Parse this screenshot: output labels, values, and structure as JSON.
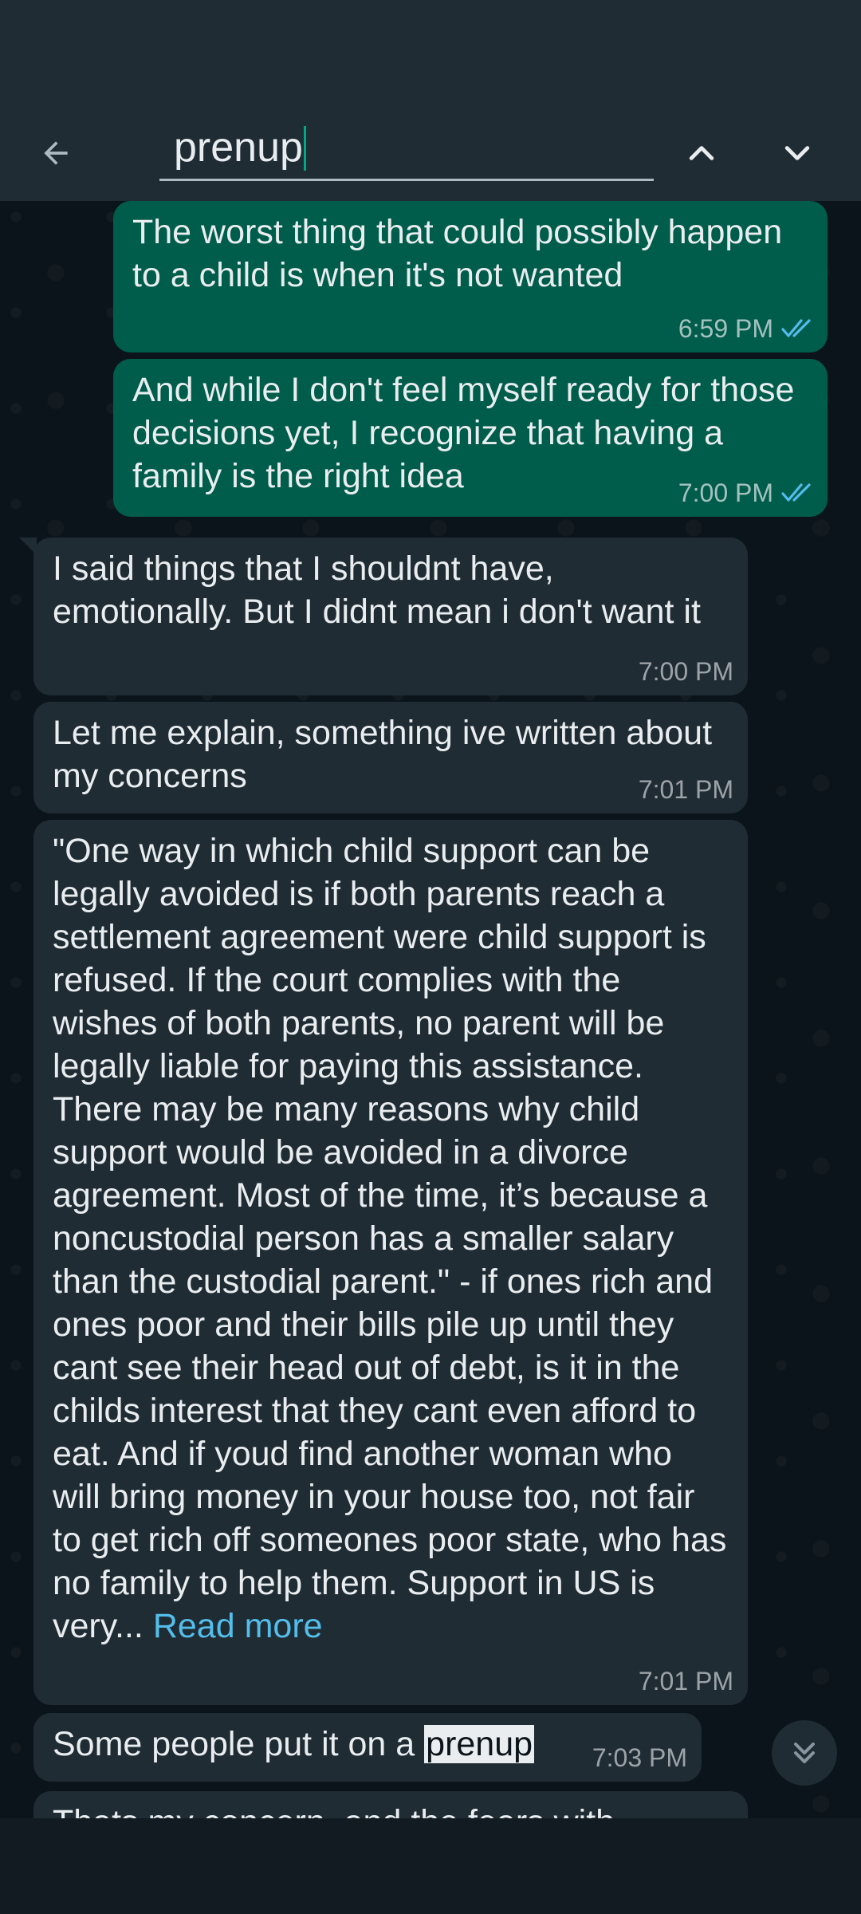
{
  "search": {
    "value": "prenup"
  },
  "messages": [
    {
      "type": "out",
      "text": "The worst thing that could possibly happen to a child is when it's not wanted",
      "time": "6:59 PM"
    },
    {
      "type": "out",
      "text": "And while I don't feel myself ready for those decisions yet, I recognize that having a family is the right idea",
      "time": "7:00 PM"
    },
    {
      "type": "in",
      "text": "I said things that I shouldnt have, emotionally. But I didnt mean i don't want it",
      "time": "7:00 PM"
    },
    {
      "type": "in",
      "text": "Let me explain, something ive written about my concerns",
      "time": "7:01 PM"
    },
    {
      "type": "in",
      "text": "\"One way in which child support can be legally avoided is if both parents reach a settlement agreement were child support is refused. If the court complies with the wishes of both parents, no parent will be legally liable for paying this assistance. There may be many reasons why child support would be avoided in a divorce agreement. Most of the time, it’s because a noncustodial person has a smaller salary than the custodial parent.\" - if ones rich and ones poor and their bills pile up until they cant see their head out of debt, is it in the childs interest that they cant even afford to eat. And if youd find another woman who will bring money in your house too, not fair to get rich off someones poor state, who has no family to help them. Support in US is very...",
      "read_more": "Read more",
      "time": "7:01 PM"
    },
    {
      "type": "in",
      "text_before": "Some people put it on a ",
      "highlight": "prenup",
      "time": "7:03 PM"
    },
    {
      "type": "in",
      "text": "Thats my concern, and the fears with"
    }
  ],
  "colors": {
    "outgoing_bubble": "#005c4b",
    "incoming_bubble": "#202c33",
    "link": "#53bdeb",
    "read_tick": "#53bdeb"
  },
  "icons": {
    "back": "arrow-left",
    "prev": "chevron-up",
    "next": "chevron-down",
    "read": "double-check",
    "scroll": "double-chevron-down"
  }
}
